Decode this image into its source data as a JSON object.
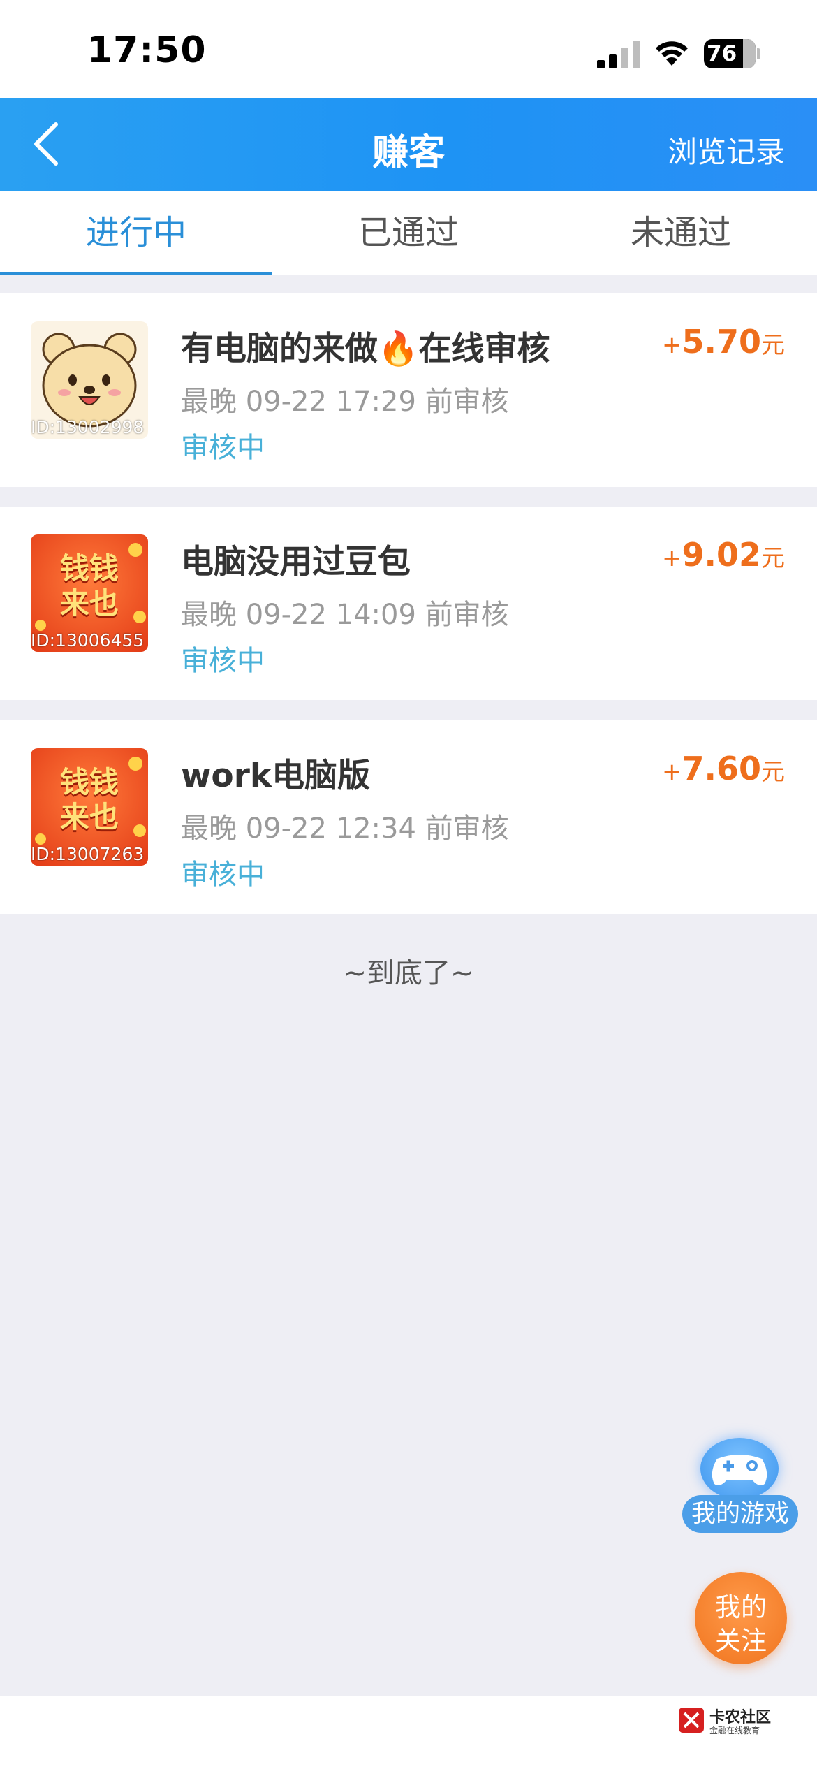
{
  "status_bar": {
    "time": "17:50",
    "battery": "76"
  },
  "nav": {
    "title": "赚客",
    "right_link": "浏览记录"
  },
  "tabs": [
    {
      "label": "进行中",
      "active": true
    },
    {
      "label": "已通过",
      "active": false
    },
    {
      "label": "未通过",
      "active": false
    }
  ],
  "tasks": [
    {
      "title": "有电脑的来做🔥在线审核",
      "deadline": "最晚 09-22 17:29 前审核",
      "status": "审核中",
      "reward_plus": "+",
      "reward_amount": "5.70",
      "reward_unit": "元",
      "id_tag": "ID:13002998",
      "thumb": "bear-cartoon"
    },
    {
      "title": "电脑没用过豆包",
      "deadline": "最晚 09-22 14:09 前审核",
      "status": "审核中",
      "reward_plus": "+",
      "reward_amount": "9.02",
      "reward_unit": "元",
      "id_tag": "ID:13006455",
      "thumb": "qianqian-laiye",
      "thumb_text": [
        "钱钱",
        "来也"
      ]
    },
    {
      "title": "work电脑版",
      "deadline": "最晚 09-22 12:34 前审核",
      "status": "审核中",
      "reward_plus": "+",
      "reward_amount": "7.60",
      "reward_unit": "元",
      "id_tag": "ID:13007263",
      "thumb": "qianqian-laiye",
      "thumb_text": [
        "钱钱",
        "来也"
      ]
    }
  ],
  "end_text": "~到底了~",
  "floating": {
    "game_label": "我的游戏",
    "follow_line1": "我的",
    "follow_line2": "关注"
  },
  "watermark": {
    "name": "卡农社区",
    "sub": "金融在线教育"
  },
  "colors": {
    "nav_blue": "#1e93f4",
    "active_tab": "#2a8fd8",
    "reward_orange": "#ee6e1c",
    "status_teal": "#48b0d8"
  }
}
